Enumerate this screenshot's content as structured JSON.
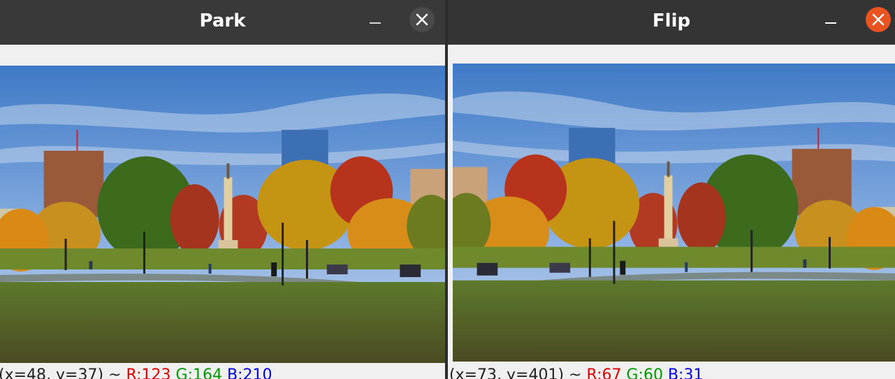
{
  "windows": [
    {
      "title": "Park",
      "status": {
        "coords": "(x=48, y=37) ~",
        "r": "R:123",
        "g": "G:164",
        "b": "B:210"
      },
      "close_color": "#4a4a4a"
    },
    {
      "title": "Flip",
      "status": {
        "coords": "(x=73, y=401) ~",
        "r": "R:67",
        "g": "G:60",
        "b": "B:31"
      },
      "close_color": "#e95420"
    }
  ],
  "icons": {
    "minimize": "minimize-icon",
    "close": "close-icon"
  },
  "colors": {
    "titlebar": "#393939",
    "close_active": "#e95420",
    "close_inactive": "#4a4a4a",
    "status_r": "#e00000",
    "status_g": "#009a00",
    "status_b": "#0000e0"
  }
}
